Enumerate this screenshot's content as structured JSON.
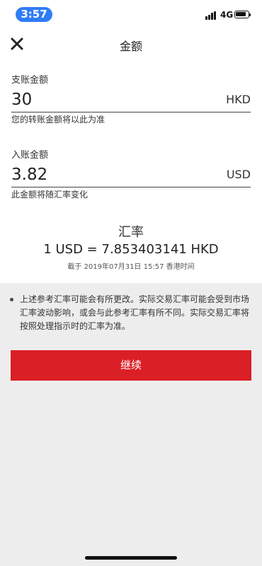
{
  "status_bar": {
    "time": "3:57",
    "network": "4G"
  },
  "header": {
    "title": "金额"
  },
  "pay": {
    "label": "支账金额",
    "amount": "30",
    "currency": "HKD",
    "hint": "您的转账金额将以此为准"
  },
  "receive": {
    "label": "入账金额",
    "amount": "3.82",
    "currency": "USD",
    "hint": "此金额将随汇率变化"
  },
  "rate": {
    "title": "汇率",
    "value": "1 USD = 7.853403141 HKD",
    "as_of": "截于 2019年07月31日 15:57 香港时间"
  },
  "notice": {
    "text": "上述参考汇率可能会有所更改。实际交易汇率可能会受到市场汇率波动影响，或会与此参考汇率有所不同。实际交易汇率将按照处理指示时的汇率为准。"
  },
  "actions": {
    "continue_label": "继续"
  },
  "colors": {
    "accent": "#db1f26",
    "time_pill": "#2f7cf6"
  }
}
